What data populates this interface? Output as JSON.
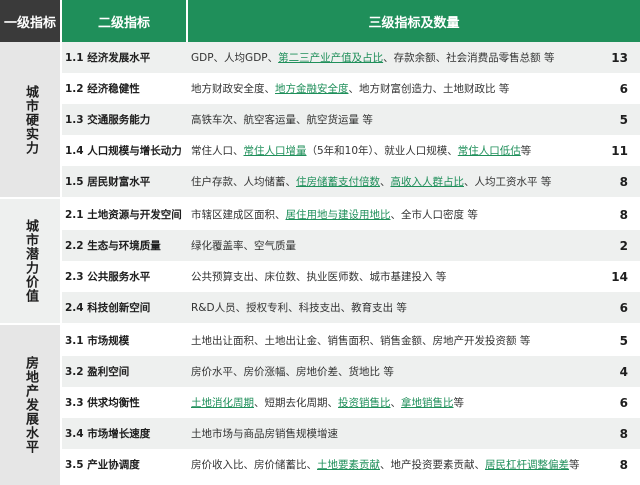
{
  "header": {
    "level1": "一级指标",
    "level2": "二级指标",
    "level3": "三级指标及数量"
  },
  "colors": {
    "header_green": "#1f8f5a",
    "header_dark": "#3a3a3a",
    "highlight_green": "#1f8f5a",
    "category_bg": "#e6e6e6",
    "row_shade": "#eef0ef"
  },
  "categories": [
    {
      "label": "城市硬实力"
    },
    {
      "label": "城市潜力价值"
    },
    {
      "label": "房地产发展水平"
    }
  ],
  "rows": [
    {
      "l2": "1.1 经济发展水平",
      "count": "13",
      "l3": [
        {
          "t": "GDP、人均GDP、"
        },
        {
          "t": "第二三产业产值及占比",
          "hl": true
        },
        {
          "t": "、存款余额、社会消费品零售总额 等"
        }
      ]
    },
    {
      "l2": "1.2 经济稳健性",
      "count": "6",
      "l3": [
        {
          "t": "地方财政安全度、"
        },
        {
          "t": "地方金融安全度",
          "hl": true
        },
        {
          "t": "、地方财富创造力、土地财政比 等"
        }
      ]
    },
    {
      "l2": "1.3 交通服务能力",
      "count": "5",
      "l3": [
        {
          "t": "高铁车次、航空客运量、航空货运量 等"
        }
      ]
    },
    {
      "l2": "1.4 人口规模与增长动力",
      "count": "11",
      "l3": [
        {
          "t": "常住人口、"
        },
        {
          "t": "常住人口增量",
          "hl": true
        },
        {
          "t": "（5年和10年）、就业人口规模、"
        },
        {
          "t": "常住人口低估",
          "hl": true
        },
        {
          "t": " 等"
        }
      ]
    },
    {
      "l2": "1.5 居民财富水平",
      "count": "8",
      "l3": [
        {
          "t": "住户存款、人均储蓄、"
        },
        {
          "t": "住房储蓄支付倍数",
          "hl": true
        },
        {
          "t": "、"
        },
        {
          "t": "高收入人群占比",
          "hl": true
        },
        {
          "t": "、人均工资水平 等"
        }
      ]
    },
    {
      "l2": "2.1 土地资源与开发空间",
      "count": "8",
      "l3": [
        {
          "t": "市辖区建成区面积、"
        },
        {
          "t": "居住用地与建设用地比",
          "hl": true
        },
        {
          "t": "、全市人口密度 等"
        }
      ]
    },
    {
      "l2": "2.2 生态与环境质量",
      "count": "2",
      "l3": [
        {
          "t": "绿化覆盖率、空气质量"
        }
      ]
    },
    {
      "l2": "2.3 公共服务水平",
      "count": "14",
      "l3": [
        {
          "t": "公共预算支出、床位数、执业医师数、城市基建投入 等"
        }
      ]
    },
    {
      "l2": "2.4 科技创新空间",
      "count": "6",
      "l3": [
        {
          "t": "R&D人员、授权专利、科技支出、教育支出 等"
        }
      ]
    },
    {
      "l2": "3.1 市场规模",
      "count": "5",
      "l3": [
        {
          "t": "土地出让面积、土地出让金、销售面积、销售金额、房地产开发投资额 等"
        }
      ]
    },
    {
      "l2": "3.2 盈利空间",
      "count": "4",
      "l3": [
        {
          "t": "房价水平、房价涨幅、房地价差、货地比 等"
        }
      ]
    },
    {
      "l2": "3.3 供求均衡性",
      "count": "6",
      "l3": [
        {
          "t": "土地消化周期",
          "hl": true
        },
        {
          "t": "、短期去化周期、"
        },
        {
          "t": "投资销售比",
          "hl": true
        },
        {
          "t": "、"
        },
        {
          "t": "拿地销售比",
          "hl": true
        },
        {
          "t": " 等"
        }
      ]
    },
    {
      "l2": "3.4 市场增长速度",
      "count": "8",
      "l3": [
        {
          "t": "土地市场与商品房销售规模增速"
        }
      ]
    },
    {
      "l2": "3.5 产业协调度",
      "count": "8",
      "l3": [
        {
          "t": "房价收入比、房价储蓄比、"
        },
        {
          "t": "土地要素贡献",
          "hl": true
        },
        {
          "t": "、地产投资要素贡献、"
        },
        {
          "t": "居民杠杆调整偏差",
          "hl": true
        },
        {
          "t": " 等"
        }
      ]
    }
  ]
}
